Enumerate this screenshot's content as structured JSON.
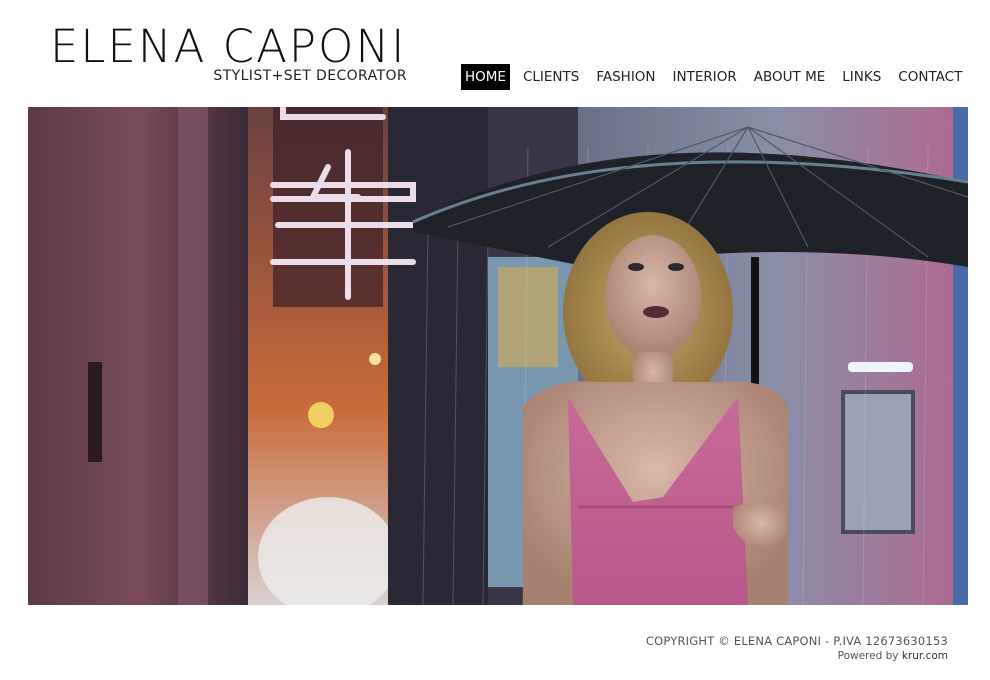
{
  "brand": {
    "name": "ELENA CAPONI",
    "tagline": "STYLIST+SET DECORATOR"
  },
  "nav": {
    "items": [
      {
        "label": "HOME",
        "active": true
      },
      {
        "label": "CLIENTS"
      },
      {
        "label": "FASHION"
      },
      {
        "label": "INTERIOR"
      },
      {
        "label": "ABOUT ME"
      },
      {
        "label": "LINKS"
      },
      {
        "label": "CONTACT"
      }
    ]
  },
  "hero": {
    "neon_sign": "车"
  },
  "footer": {
    "copyright": "COPYRIGHT © ELENA CAPONI - P.IVA 12673630153",
    "powered_prefix": "Powered by",
    "powered_link": "krur.com"
  },
  "colors": {
    "accent": "#000000",
    "text": "#222222",
    "footer_text": "#555555"
  }
}
